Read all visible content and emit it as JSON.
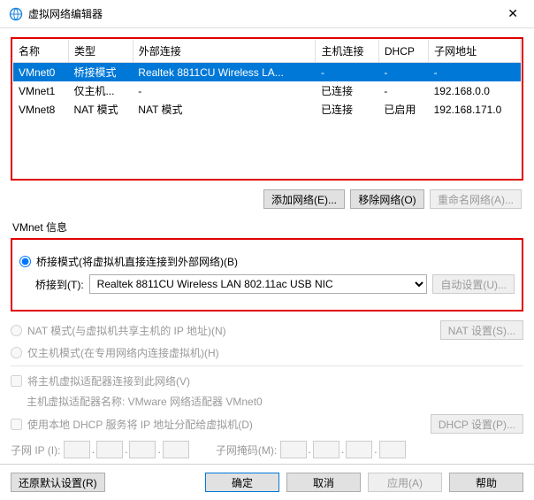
{
  "window": {
    "title": "虚拟网络编辑器"
  },
  "table": {
    "cols": [
      "名称",
      "类型",
      "外部连接",
      "主机连接",
      "DHCP",
      "子网地址"
    ],
    "rows": [
      {
        "name": "VMnet0",
        "type": "桥接模式",
        "ext": "Realtek 8811CU Wireless LA...",
        "host": "-",
        "dhcp": "-",
        "subnet": "-",
        "sel": true
      },
      {
        "name": "VMnet1",
        "type": "仅主机...",
        "ext": "-",
        "host": "已连接",
        "dhcp": "-",
        "subnet": "192.168.0.0"
      },
      {
        "name": "VMnet8",
        "type": "NAT 模式",
        "ext": "NAT 模式",
        "host": "已连接",
        "dhcp": "已启用",
        "subnet": "192.168.171.0"
      }
    ]
  },
  "btns": {
    "add": "添加网络(E)...",
    "remove": "移除网络(O)",
    "rename": "重命名网络(A)..."
  },
  "group": {
    "label": "VMnet 信息"
  },
  "modes": {
    "bridge": "桥接模式(将虚拟机直接连接到外部网络)(B)",
    "bridge_to": "桥接到(T):",
    "bridge_sel": "Realtek 8811CU Wireless LAN 802.11ac USB NIC",
    "auto": "自动设置(U)...",
    "nat": "NAT 模式(与虚拟机共享主机的 IP 地址)(N)",
    "nat_btn": "NAT 设置(S)...",
    "hostonly": "仅主机模式(在专用网络内连接虚拟机)(H)"
  },
  "hostadapter": {
    "chk": "将主机虚拟适配器连接到此网络(V)",
    "sub": "主机虚拟适配器名称: VMware 网络适配器 VMnet0"
  },
  "dhcp": {
    "chk": "使用本地 DHCP 服务将 IP 地址分配给虚拟机(D)",
    "btn": "DHCP 设置(P)..."
  },
  "subnet": {
    "ip_label": "子网 IP (I):",
    "mask_label": "子网掩码(M):"
  },
  "footer": {
    "restore": "还原默认设置(R)",
    "ok": "确定",
    "cancel": "取消",
    "apply": "应用(A)",
    "help": "帮助"
  }
}
